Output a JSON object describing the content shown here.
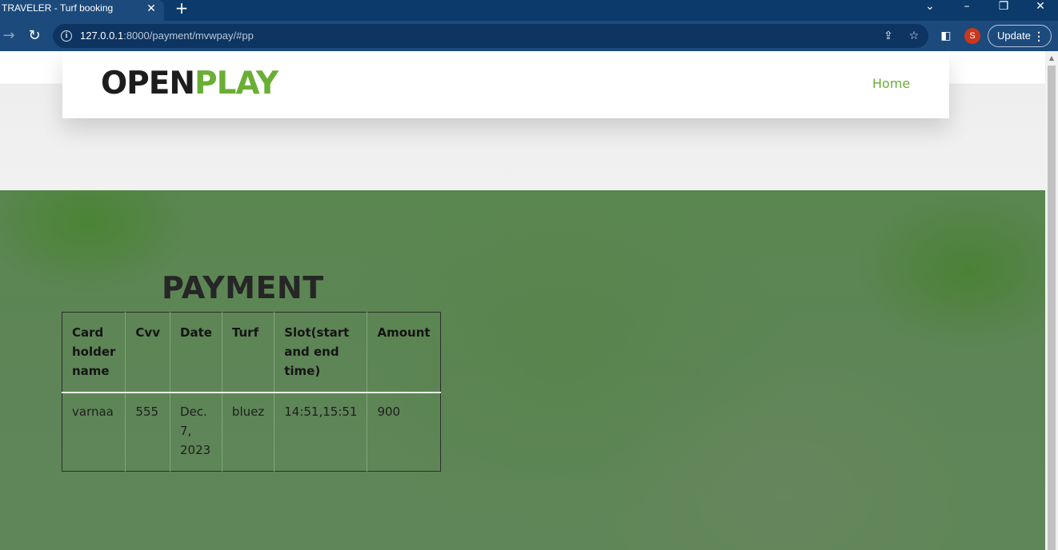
{
  "browser": {
    "tab_title": "TRAVELER - Turf booking",
    "tab_close": "✕",
    "new_tab": "+",
    "url_host": "127.0.0.1",
    "url_rest": ":8000/payment/mvwpay/#pp",
    "avatar_letter": "S",
    "update_label": "Update"
  },
  "header": {
    "logo_part1": "OPEN",
    "logo_part2": "PLAY",
    "nav_home": "Home"
  },
  "payment": {
    "title": "PAYMENT",
    "columns": [
      "Card holder name",
      "Cvv",
      "Date",
      "Turf",
      "Slot(start and end time)",
      "Amount"
    ],
    "rows": [
      [
        "varnaa",
        "555",
        "Dec. 7, 2023",
        "bluez",
        "14:51,15:51",
        "900"
      ]
    ]
  },
  "colors": {
    "accent_green": "#6aae35",
    "chrome_blue": "#1c4a7c",
    "avatar_red": "#c9371b"
  },
  "icons": [
    "back-arrow-icon",
    "reload-icon",
    "info-icon",
    "share-icon",
    "star-icon",
    "sidepanel-icon",
    "menu-dots-icon",
    "minimize-icon",
    "restore-icon",
    "close-icon",
    "tab-search-icon"
  ]
}
